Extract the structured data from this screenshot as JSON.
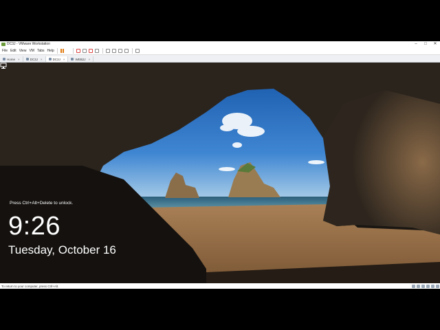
{
  "window": {
    "title": "DC3J - VMware Workstation",
    "minimize_glyph": "–",
    "maximize_glyph": "□",
    "close_glyph": "✕"
  },
  "menubar": {
    "items": [
      "File",
      "Edit",
      "View",
      "VM",
      "Tabs",
      "Help"
    ]
  },
  "tabs": [
    {
      "label": "Home",
      "icon": "home-icon"
    },
    {
      "label": "DC3J",
      "icon": "vm-icon"
    },
    {
      "label": "DC3J",
      "icon": "vm-icon",
      "active": true
    },
    {
      "label": "WEB2J",
      "icon": "vm-icon"
    }
  ],
  "lockscreen": {
    "hint": "Press Ctrl+Alt+Delete to unlock.",
    "time": "9:26",
    "date": "Tuesday, October 16",
    "network_icon": "network-icon"
  },
  "statusbar": {
    "text": "To return to your computer, press Ctrl+Alt."
  },
  "colors": {
    "toolbar_accent": "#e07a10",
    "sky": "#2f6fb8",
    "sand": "#c89660",
    "cave": "#2a241e"
  }
}
